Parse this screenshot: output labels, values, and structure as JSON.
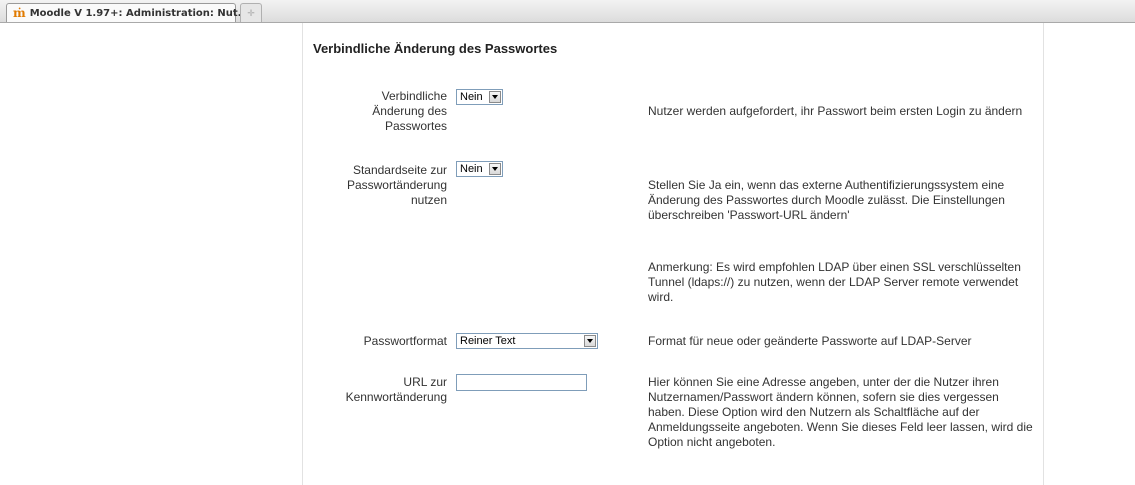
{
  "browser": {
    "tab_title": "Moodle V 1.97+: Administration: Nut...",
    "tab_icon": "moodle-logo-icon",
    "new_tab_icon": "new-tab-icon"
  },
  "section": {
    "heading": "Verbindliche Änderung des Passwortes"
  },
  "settings": {
    "force_change": {
      "label_lines": [
        "Verbindliche",
        "Änderung des",
        "Passwortes"
      ],
      "value": "Nein",
      "description": "Nutzer werden aufgefordert, ihr Passwort beim ersten Login zu ändern"
    },
    "std_change_page": {
      "label_lines": [
        "Standardseite zur",
        "Passwortänderung",
        "nutzen"
      ],
      "value": "Nein",
      "description": "Stellen Sie Ja ein, wenn das externe Authentifizierungssystem eine Änderung des Passwortes durch Moodle zulässt. Die Einstellungen überschreiben 'Passwort-URL ändern'",
      "note": "Anmerkung: Es wird empfohlen LDAP über einen SSL verschlüsselten Tunnel (ldaps://) zu nutzen, wenn der LDAP Server remote verwendet wird."
    },
    "password_format": {
      "label": "Passwortformat",
      "value": "Reiner Text",
      "description": "Format für neue oder geänderte Passworte auf LDAP-Server"
    },
    "change_url": {
      "label_lines": [
        "URL zur",
        "Kennwortänderung"
      ],
      "value": "",
      "description": "Hier können Sie eine Adresse angeben, unter der die Nutzer ihren Nutzernamen/Passwort ändern können, sofern sie dies vergessen haben. Diese Option wird den Nutzern als Schaltfläche auf der Anmeldungsseite angeboten. Wenn Sie dieses Feld leer lassen, wird die Option nicht angeboten."
    }
  },
  "colors": {
    "input_border": "#7f9db9",
    "tab_icon": "#e07a00",
    "column_border": "#e2e2e2"
  }
}
